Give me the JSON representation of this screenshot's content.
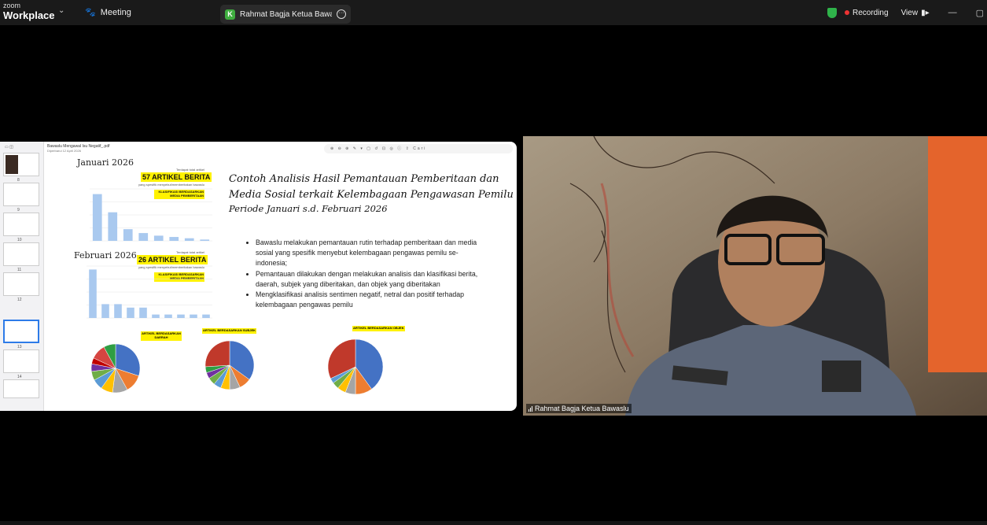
{
  "topbar": {
    "logo_small": "zoom",
    "logo_big": "Workplace",
    "meeting_label": "Meeting",
    "share_tab_badge": "K",
    "share_tab_label": "Rahmat Bagja Ketua Bawaslu's sc",
    "recording_label": "Recording",
    "view_label": "View",
    "recording_color": "#ee3333",
    "shield_color": "#2fb34a"
  },
  "pdf_viewer": {
    "title": "Bawaslu Mengawal Isu Negatif_.pdf",
    "subtitle": "Diperbarui 12 April 2026",
    "tools": "⊕ ⊖ ⊕ ✎ ▾ ▢ ↺ ⊡ ◎ ⓘ ⇪ Cari",
    "page_numbers": [
      "1",
      "2",
      "3",
      "4",
      "5",
      "6",
      "7",
      "8",
      "9",
      "10",
      "11",
      "12",
      "13",
      "14"
    ]
  },
  "slide": {
    "title_line1": "Contoh Analisis Hasil Pemantauan Pemberitaan dan",
    "title_line2": "Media Sosial terkait Kelembagaan Pengawasan Pemilu",
    "period": "Periode Januari  s.d. Februari 2026",
    "bullets": [
      "Bawaslu melakukan pemantauan rutin terhadap pemberitaan dan media sosial yang spesifik menyebut kelembagaan pengawas pemilu se-indonesia;",
      "Pemantauan dilakukan dengan melakukan analisis dan klasifikasi berita, daerah, subjek yang diberitakan, dan objek yang diberitakan",
      "Mengklasifikasi analisis sentimen negatif, netral dan positif terhadap kelembagaan pengawas pemilu"
    ],
    "jan": {
      "month": "Januari 2026",
      "total_note": "Terdapat total artikel",
      "count": "57 ARTIKEL BERITA",
      "count_note": "yang spesifik menyebut/memberitakan bawaslu",
      "class_label": "KLASIFIKASI BERDASARKAN MEDIA PEMBERITAAN"
    },
    "feb": {
      "month": "Februari 2026",
      "total_note": "Terdapat total artikel",
      "count": "26 ARTIKEL BERITA",
      "count_note": "yang spesifik menyebut/memberitakan bawaslu",
      "class_label": "KLASIFIKASI BERDASARKAN MEDIA PEMBERITAAN"
    },
    "pie_labels": [
      "ARTIKEL BERDASARKAN DAERAH",
      "ARTIKEL BERDASARKAN SUBJEK",
      "ARTIKEL BERDASARKAN OBJEK"
    ]
  },
  "chart_data": [
    {
      "type": "bar",
      "values": [
        36,
        22,
        9,
        6,
        4,
        3,
        2,
        1
      ],
      "ylim": [
        0,
        40
      ]
    },
    {
      "type": "bar",
      "values": [
        14,
        4,
        4,
        3,
        3,
        1,
        1,
        1,
        1,
        1
      ],
      "ylim": [
        0,
        15
      ]
    },
    {
      "type": "pie",
      "values": [
        30,
        12,
        10,
        8,
        7,
        6,
        5,
        4,
        10,
        8
      ],
      "colors": [
        "#4472c4",
        "#ed7d31",
        "#a5a5a5",
        "#ffc000",
        "#5b9bd5",
        "#70ad47",
        "#7030a0",
        "#c00000",
        "#d64541",
        "#2f9e44"
      ]
    },
    {
      "type": "pie",
      "values": [
        35,
        8,
        7,
        6,
        5,
        5,
        4,
        4,
        26
      ],
      "colors": [
        "#4472c4",
        "#ed7d31",
        "#a5a5a5",
        "#ffc000",
        "#5b9bd5",
        "#70ad47",
        "#7030a0",
        "#2f9e44",
        "#c0392b"
      ]
    },
    {
      "type": "pie",
      "values": [
        40,
        10,
        6,
        5,
        4,
        3,
        32
      ],
      "colors": [
        "#4472c4",
        "#ed7d31",
        "#a5a5a5",
        "#ffc000",
        "#70ad47",
        "#5b9bd5",
        "#c0392b"
      ]
    }
  ],
  "video": {
    "participant_name": "Rahmat Bagja Ketua Bawaslu"
  }
}
